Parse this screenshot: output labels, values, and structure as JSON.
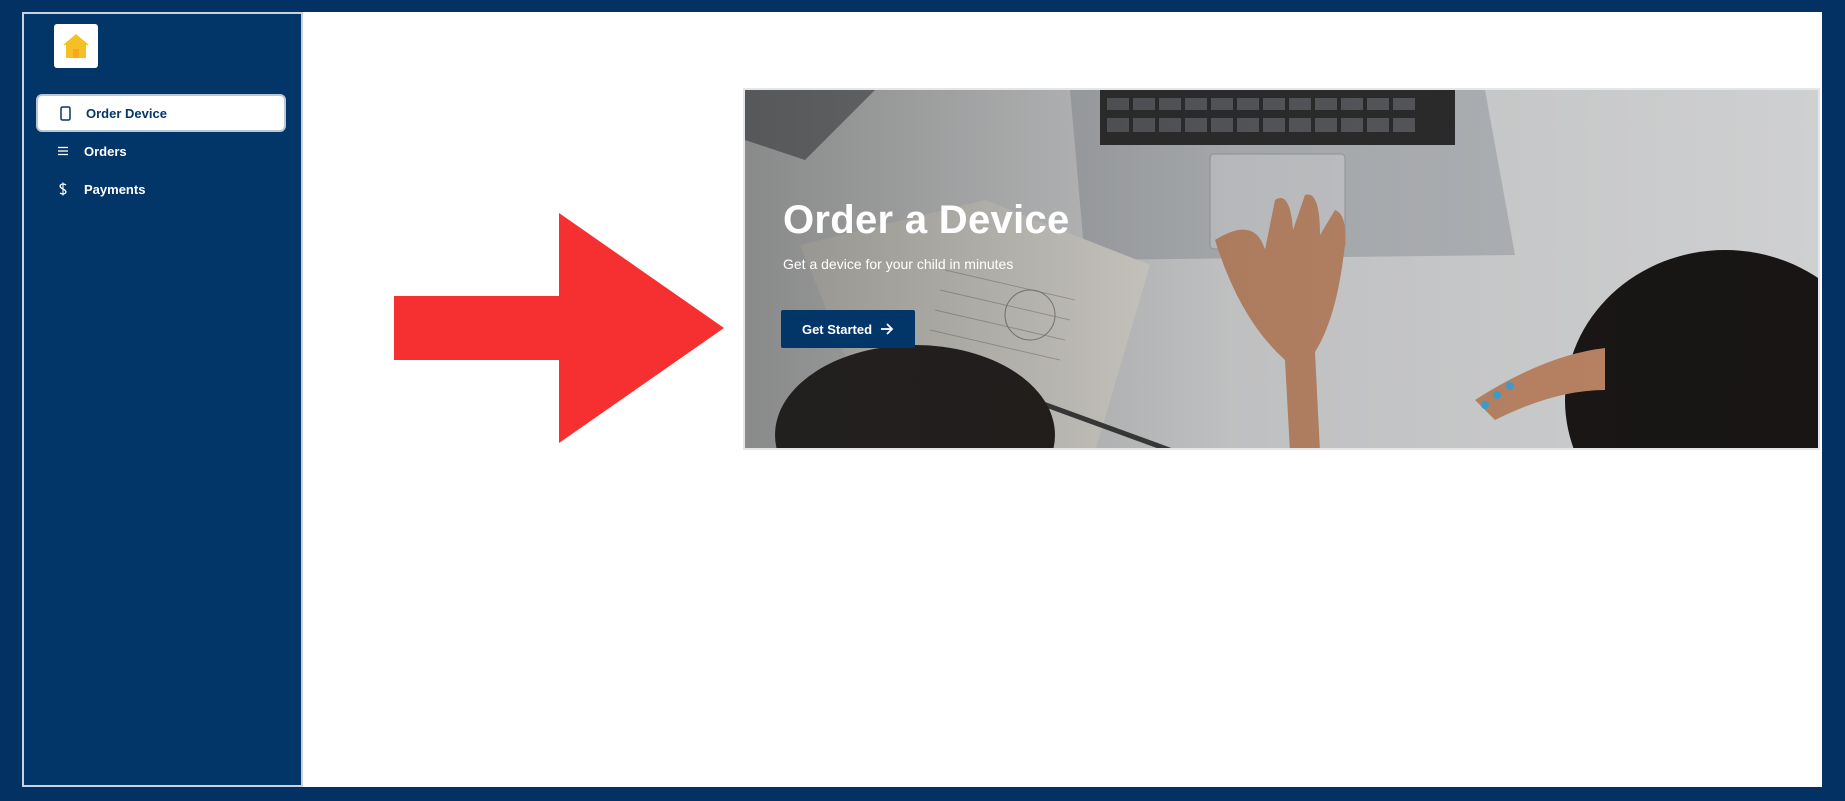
{
  "colors": {
    "frame": "#033163",
    "sidebar": "#033668",
    "accent_button": "#033668",
    "arrow": "#f62f30",
    "logo_yellow": "#f5bf26"
  },
  "sidebar": {
    "logo_icon": "house-logo-icon",
    "items": [
      {
        "label": "Order Device",
        "icon": "phone-icon",
        "active": true
      },
      {
        "label": "Orders",
        "icon": "list-icon",
        "active": false
      },
      {
        "label": "Payments",
        "icon": "dollar-icon",
        "active": false
      }
    ]
  },
  "hero": {
    "title": "Order a Device",
    "subtitle": "Get a device for your child in minutes",
    "button_label": "Get Started",
    "button_icon": "arrow-right-icon"
  },
  "annotation": {
    "icon": "big-red-arrow-icon"
  }
}
